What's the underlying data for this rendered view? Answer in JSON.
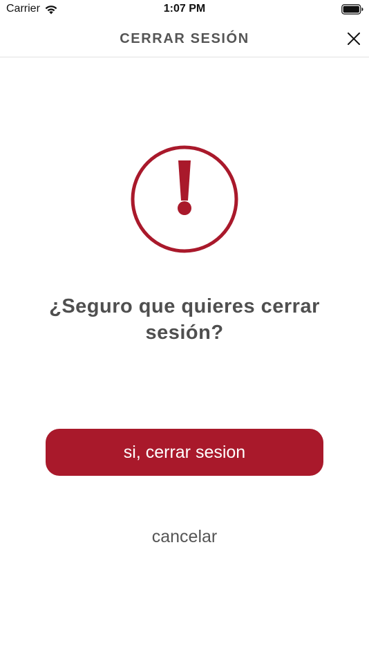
{
  "status_bar": {
    "carrier": "Carrier",
    "time": "1:07 PM",
    "wifi_icon": "wifi-icon",
    "battery_icon": "battery-full-icon"
  },
  "nav": {
    "title": "CERRAR SESIÓN",
    "close_icon": "close-icon"
  },
  "alert": {
    "icon": "exclamation-circle-icon",
    "icon_color": "#a9192b",
    "question": "¿Seguro que quieres cerrar sesión?"
  },
  "actions": {
    "confirm_label": "si, cerrar sesion",
    "confirm_color": "#a9192b",
    "cancel_label": "cancelar"
  }
}
